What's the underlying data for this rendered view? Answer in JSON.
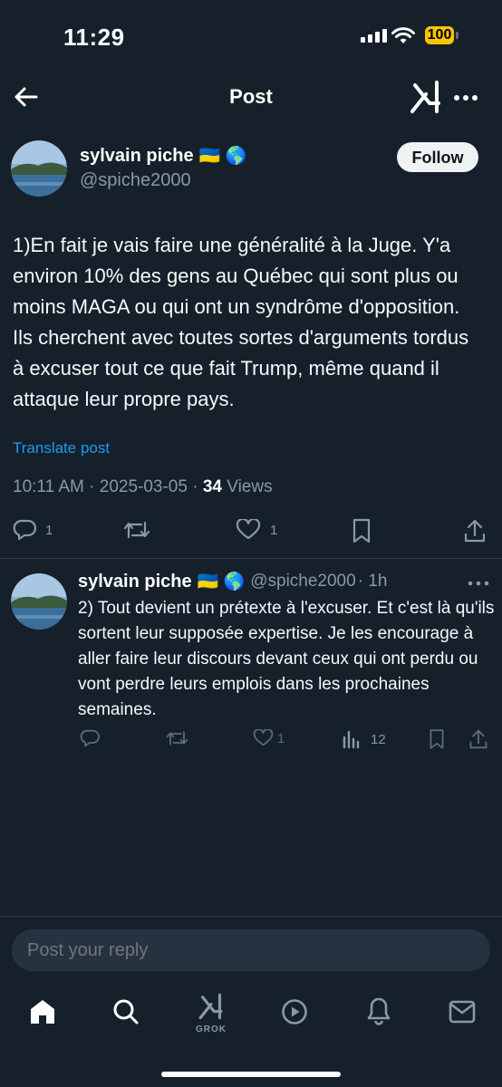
{
  "status_bar": {
    "time": "11:29",
    "battery": "100"
  },
  "header": {
    "title": "Post"
  },
  "tweet": {
    "author_name": "sylvain piche",
    "author_flags": "🇺🇦 🌎",
    "handle": "@spiche2000",
    "follow_label": "Follow",
    "text": "1)En fait je vais faire une généralité à la Juge. Y'a environ 10% des gens au Québec qui sont plus ou moins MAGA ou qui ont un syndrôme d'opposition. Ils cherchent avec toutes sortes d'arguments tordus à excuser tout ce que fait Trump, même quand il attaque leur propre pays.",
    "translate_label": "Translate post",
    "timestamp": "10:11 AM · 2025-03-05 · ",
    "views_count": "34",
    "views_label": " Views",
    "actions": {
      "replies": "1",
      "retweets": "",
      "likes": "1"
    }
  },
  "reply": {
    "author_name": "sylvain piche",
    "author_flags": "🇺🇦 🌎",
    "handle": "@spiche2000",
    "time": "· 1h",
    "text": "2) Tout devient un prétexte à l'excuser. Et c'est là qu'ils sortent leur supposée expertise. Je les encourage à aller faire leur discours devant ceux qui ont perdu ou vont perdre leurs emplois dans les prochaines semaines.",
    "actions": {
      "replies": "",
      "retweets": "",
      "likes": "1",
      "views": "12"
    }
  },
  "composer": {
    "placeholder": "Post your reply"
  },
  "tab_bar": {
    "grok_label": "GROK"
  },
  "colors": {
    "background": "#15202b",
    "accent": "#1d9bf0",
    "secondary_text": "#8b98a5",
    "divider": "#2f3b47"
  }
}
